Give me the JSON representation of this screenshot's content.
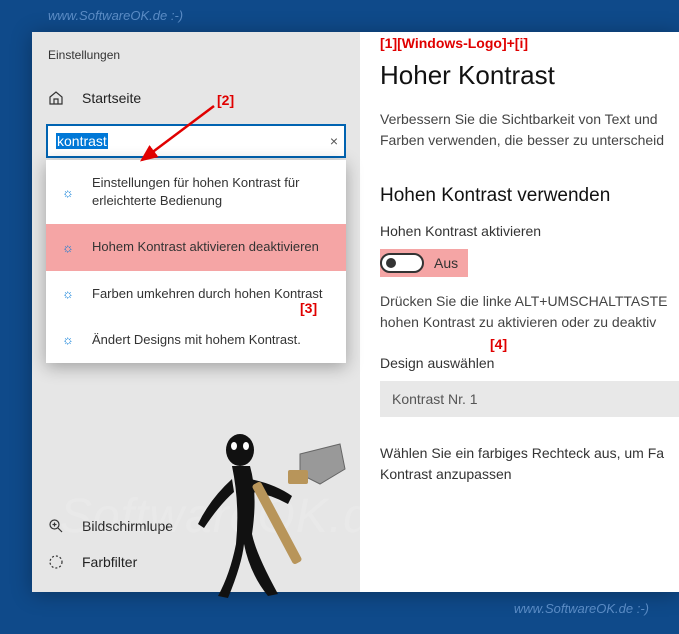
{
  "watermarks": {
    "top": "www.SoftwareOK.de :-)",
    "bottom": "www.SoftwareOK.de :-)",
    "background": "SoftwareOK.de"
  },
  "annotations": {
    "a1": "[1][Windows-Logo]+[i]",
    "a2": "[2]",
    "a3": "[3]",
    "a4": "[4]"
  },
  "sidebar": {
    "app_title": "Einstellungen",
    "home": "Startseite",
    "search": {
      "value": "kontrast",
      "clear": "×"
    },
    "results": [
      "Einstellungen für hohen Kontrast für erleichterte Bedienung",
      "Hohem Kontrast aktivieren deaktivieren",
      "Farben umkehren durch hohen Kontrast",
      "Ändert Designs mit hohem Kontrast."
    ],
    "magnifier": "Bildschirmlupe",
    "colorfilter": "Farbfilter"
  },
  "content": {
    "heading": "Hoher Kontrast",
    "description": "Verbessern Sie die Sichtbarkeit von Text und Farben verwenden, die besser zu unterscheid",
    "section": "Hohen Kontrast verwenden",
    "toggle_label": "Hohen Kontrast aktivieren",
    "toggle_state": "Aus",
    "hint": "Drücken Sie die linke ALT+UMSCHALTTASTE hohen Kontrast zu aktivieren oder zu deaktiv",
    "design_label": "Design auswählen",
    "design_value": "Kontrast Nr. 1",
    "footer": "Wählen Sie ein farbiges Rechteck aus, um Fa Kontrast anzupassen"
  }
}
